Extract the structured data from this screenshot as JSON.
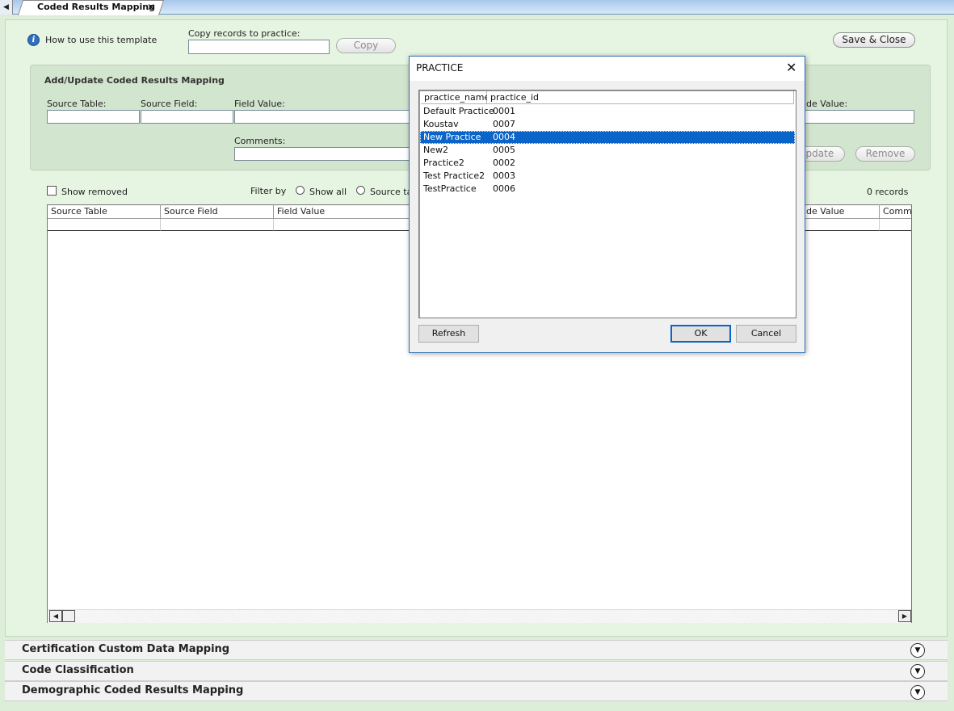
{
  "tab": {
    "label": "Coded Results Mapping",
    "close_glyph": "✕",
    "nav_glyph": "◀"
  },
  "header": {
    "howto_label": "How to use this template",
    "copy_label": "Copy records to practice:",
    "copy_value": "",
    "copy_button": "Copy",
    "save_close": "Save & Close"
  },
  "addupdate": {
    "title": "Add/Update Coded Results Mapping",
    "source_table_label": "Source Table:",
    "source_field_label": "Source Field:",
    "field_value_label": "Field Value:",
    "code_value_label": "de Value:",
    "comments_label": "Comments:",
    "update_button": "Update",
    "remove_button": "Remove"
  },
  "filters": {
    "show_removed": "Show removed",
    "filter_by": "Filter by",
    "show_all": "Show all",
    "source_table": "Source ta",
    "records": "0 records"
  },
  "grid": {
    "columns": [
      "Source Table",
      "Source Field",
      "Field Value",
      "de Value",
      "Comme"
    ]
  },
  "accordions": [
    {
      "title": "Certification Custom Data Mapping"
    },
    {
      "title": "Code Classification"
    },
    {
      "title": "Demographic Coded Results Mapping"
    }
  ],
  "dialog": {
    "title": "PRACTICE",
    "close_glyph": "✕",
    "columns": [
      "practice_name",
      "practice_id"
    ],
    "rows": [
      {
        "name": "Default Practice",
        "id": "0001"
      },
      {
        "name": "Koustav",
        "id": "0007"
      },
      {
        "name": "New Practice",
        "id": "0004"
      },
      {
        "name": "New2",
        "id": "0005"
      },
      {
        "name": "Practice2",
        "id": "0002"
      },
      {
        "name": "Test Practice2",
        "id": "0003"
      },
      {
        "name": "TestPractice",
        "id": "0006"
      }
    ],
    "selected_index": 2,
    "refresh_button": "Refresh",
    "ok_button": "OK",
    "cancel_button": "Cancel"
  },
  "colors": {
    "selection": "#0b64c8",
    "panel": "#e6f4e2",
    "dialog_border": "#2f6fb6"
  }
}
